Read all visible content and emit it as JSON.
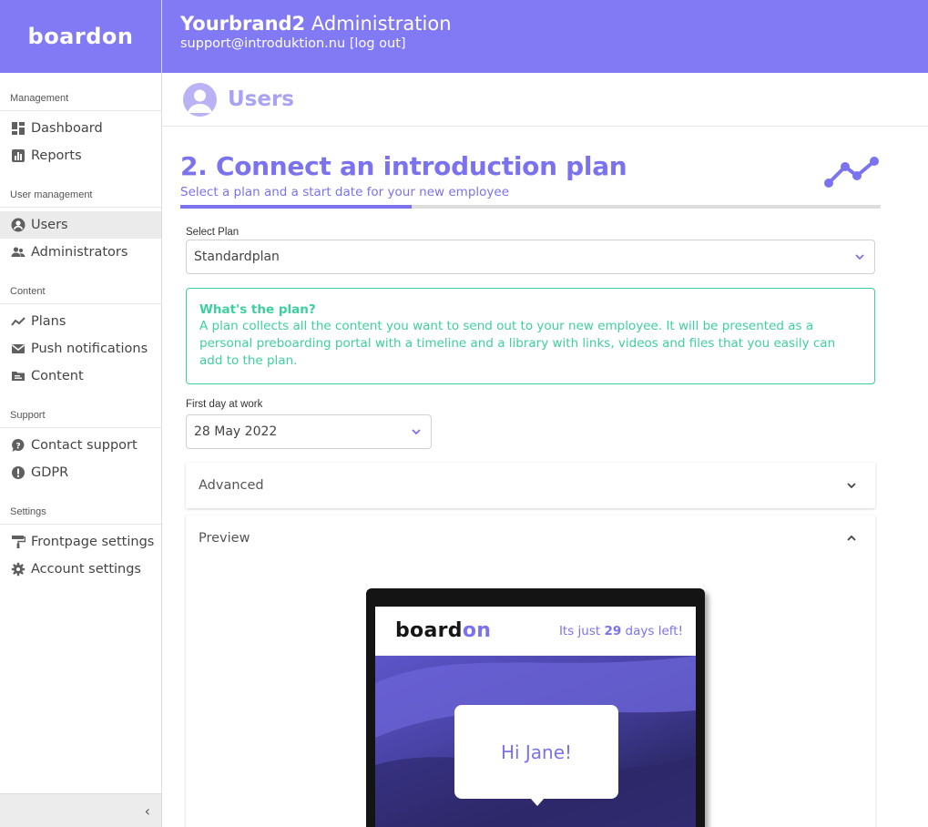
{
  "app": {
    "logo": "boardon"
  },
  "header": {
    "brand": "Yourbrand2",
    "title_suffix": " Administration",
    "email": "support@introduktion.nu",
    "logout": "[log out]"
  },
  "sidebar": {
    "sections": [
      {
        "heading": "Management",
        "items": [
          {
            "label": "Dashboard",
            "icon": "dashboard-icon"
          },
          {
            "label": "Reports",
            "icon": "bar-chart-icon"
          }
        ]
      },
      {
        "heading": "User management",
        "items": [
          {
            "label": "Users",
            "icon": "user-circle-icon",
            "active": true
          },
          {
            "label": "Administrators",
            "icon": "people-icon"
          }
        ]
      },
      {
        "heading": "Content",
        "items": [
          {
            "label": "Plans",
            "icon": "trend-line-icon"
          },
          {
            "label": "Push notifications",
            "icon": "envelope-icon"
          },
          {
            "label": "Content",
            "icon": "folder-icon"
          }
        ]
      },
      {
        "heading": "Support",
        "items": [
          {
            "label": "Contact support",
            "icon": "question-icon"
          },
          {
            "label": "GDPR",
            "icon": "exclamation-icon"
          }
        ]
      },
      {
        "heading": "Settings",
        "items": [
          {
            "label": "Frontpage settings",
            "icon": "paint-roller-icon"
          },
          {
            "label": "Account settings",
            "icon": "gear-icon"
          }
        ]
      }
    ],
    "collapse": "‹"
  },
  "page": {
    "title": "Users"
  },
  "step": {
    "title": "2. Connect an introduction plan",
    "subtitle": "Select a plan and a start date for your new employee",
    "progress": 0.33
  },
  "form": {
    "plan_label": "Select Plan",
    "plan_value": "Standardplan",
    "info_title": "What's the plan?",
    "info_text": "A plan collects all the content you want to send out to your new employee. It will be presented as a personal preboarding portal with a timeline and a library with links, videos and files that you easily can add to the plan.",
    "date_label": "First day at work",
    "date_value": "28 May 2022"
  },
  "panels": {
    "advanced": "Advanced",
    "preview": "Preview"
  },
  "preview": {
    "logo_main": "board",
    "logo_accent": "on",
    "count_prefix": "Its just ",
    "count_days": "29",
    "count_suffix": " days left!",
    "greeting": "Hi Jane!"
  },
  "colors": {
    "brand": "#8279f4",
    "accent": "#7b72ef",
    "info": "#3ecfa0"
  }
}
